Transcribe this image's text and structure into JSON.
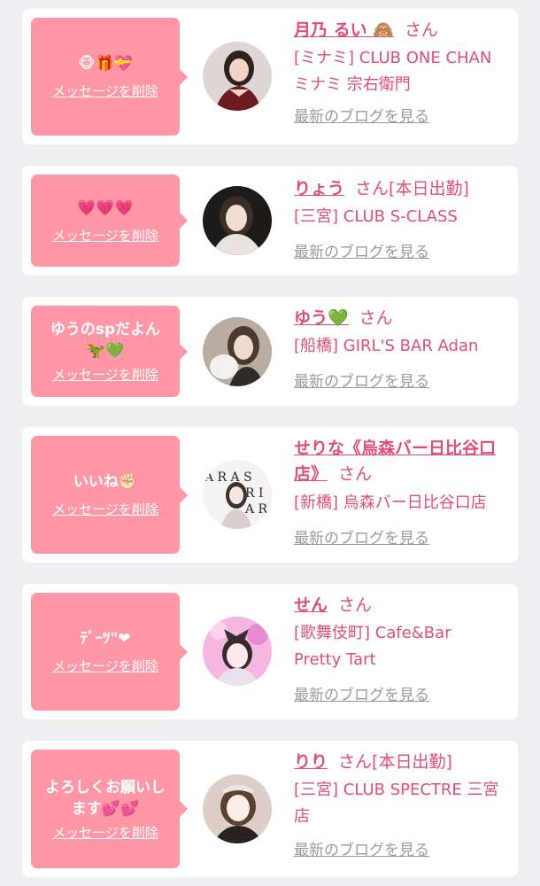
{
  "entries": [
    {
      "message": "🐵🎁💝",
      "delete_label": "メッセージを削除",
      "name": "月乃 るい 🙈",
      "honorific": "さん",
      "status": "",
      "shop": "[ミナミ] CLUB ONE CHAN ミナミ 宗右衛門",
      "blog_label": "最新のブログを見る"
    },
    {
      "message": "💗💗💗",
      "delete_label": "メッセージを削除",
      "name": "りょう",
      "honorific": "さん",
      "status": "[本日出勤]",
      "shop": "[三宮] CLUB S-CLASS",
      "blog_label": "最新のブログを見る"
    },
    {
      "message": "ゆうのspだよん🦖💚",
      "delete_label": "メッセージを削除",
      "name": "ゆう💚",
      "honorific": "さん",
      "status": "",
      "shop": "[船橋] GIRL'S BAR Adan",
      "blog_label": "最新のブログを見る"
    },
    {
      "message": "いいね✊🏻",
      "delete_label": "メッセージを削除",
      "name": "せりな《烏森バー日比谷口店》",
      "honorific": "さん",
      "status": "",
      "shop": "[新橋] 烏森バー日比谷口店",
      "blog_label": "最新のブログを見る"
    },
    {
      "message": "ﾃﾞｰﾂ\"❤",
      "delete_label": "メッセージを削除",
      "name": "せん",
      "honorific": "さん",
      "status": "",
      "shop": "[歌舞伎町] Cafe&Bar Pretty Tart",
      "blog_label": "最新のブログを見る"
    },
    {
      "message": "よろしくお願いします💕💕",
      "delete_label": "メッセージを削除",
      "name": "りり",
      "honorific": "さん",
      "status": "[本日出勤]",
      "shop": "[三宮] CLUB SPECTRE 三宮店",
      "blog_label": "最新のブログを見る"
    }
  ]
}
